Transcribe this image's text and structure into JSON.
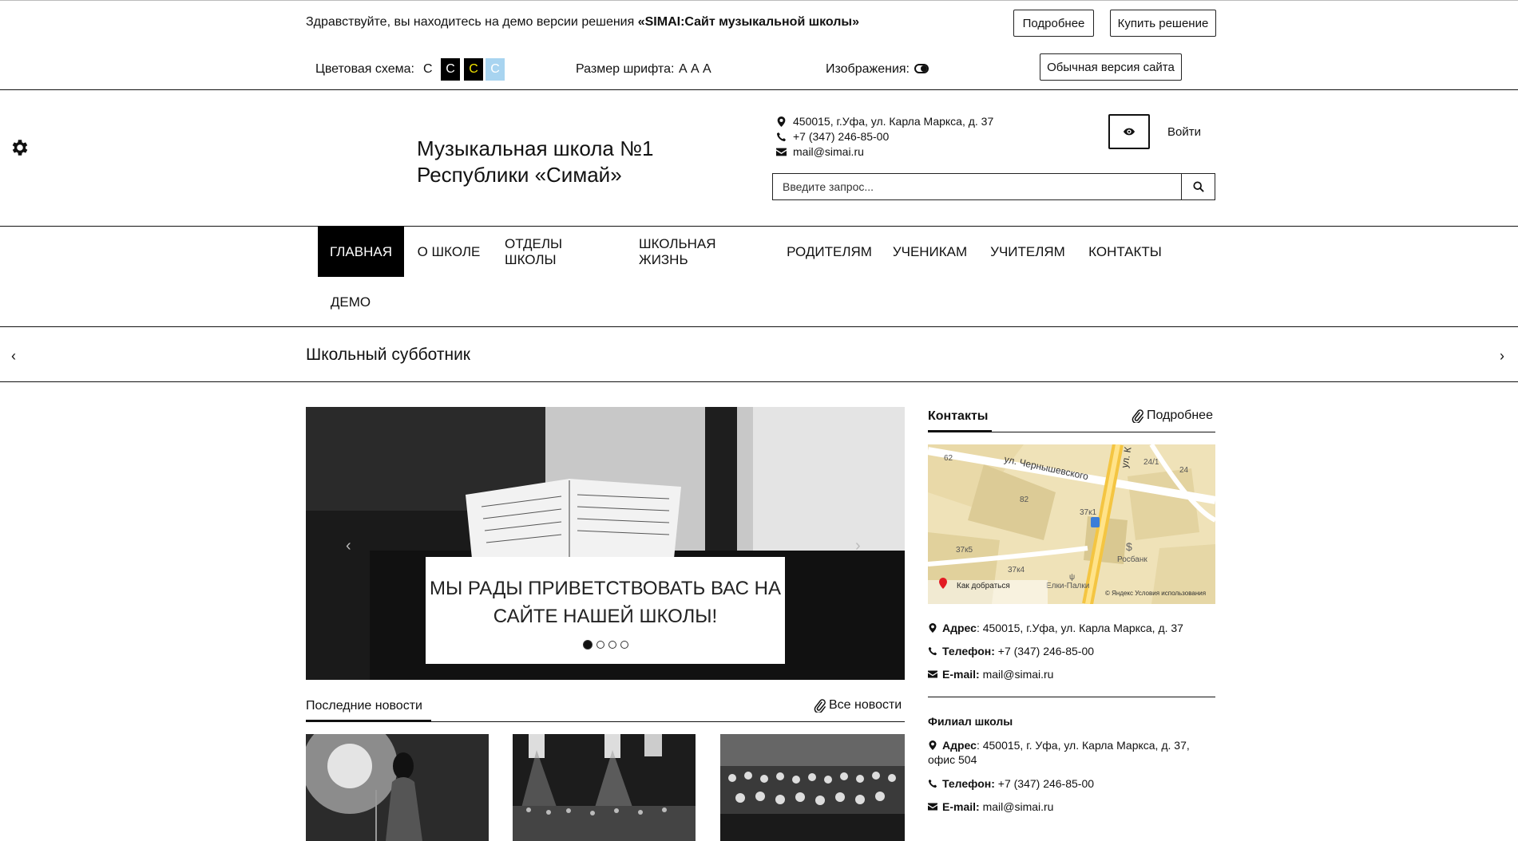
{
  "demo_bar": {
    "text_prefix": "Здравствуйте, вы находитесь на демо версии решения ",
    "text_bold": "«SIMAI:Сайт музыкальной школы»",
    "more_button": "Подробнее",
    "buy_button": "Купить решение"
  },
  "accessibility": {
    "color_scheme_label": "Цветовая схема:",
    "schemes": [
      "C",
      "C",
      "C",
      "C"
    ],
    "font_size_label": "Размер шрифта:",
    "font_sizes": [
      "A",
      "A",
      "A"
    ],
    "images_label": "Изображения:",
    "normal_version_button": "Обычная версия сайта"
  },
  "header": {
    "title_line1": "Музыкальная школа №1",
    "title_line2": "Республики «Симай»",
    "address": "450015, г.Уфа, ул. Карла Маркса, д. 37",
    "phone": "+7 (347) 246-85-00",
    "email": "mail@simai.ru",
    "search_placeholder": "Введите запрос...",
    "login": "Войти"
  },
  "nav": {
    "items": [
      "Главная",
      "О школе",
      "Отделы школы",
      "Школьная жизнь",
      "Родителям",
      "Ученикам",
      "Учителям",
      "Контакты",
      "Демо"
    ]
  },
  "ticker": {
    "text": "Школьный субботник"
  },
  "slider": {
    "caption_line1": "Мы рады приветствовать вас на",
    "caption_line2": "сайте нашей школы!",
    "slide_count": 4,
    "active_index": 0
  },
  "news": {
    "title": "Последние новости",
    "all_link": "Все новости"
  },
  "contacts": {
    "title": "Контакты",
    "more_link": "Подробнее",
    "map": {
      "street1": "ул. Чернышевского",
      "street2": "ул. К",
      "labels": [
        "62",
        "82",
        "37к1",
        "37к5",
        "37к4",
        "24/1",
        "24",
        "Росбанк",
        "Елки-Палки"
      ],
      "route": "Как добраться",
      "terms": "© Яндекс Условия использования"
    },
    "address_label": "Адрес",
    "address": ": 450015, г.Уфа, ул. Карла Маркса, д. 37",
    "phone_label": "Телефон:",
    "phone": " +7 (347) 246-85-00",
    "email_label": "E-mail:",
    "email": " mail@simai.ru",
    "branch_title": "Филиал школы",
    "branch_address_label": "Адрес",
    "branch_address": ": 450015, г. Уфа, ул. Карла Маркса, д. 37,",
    "branch_address2": "офис 504",
    "branch_phone_label": "Телефон:",
    "branch_phone": " +7 (347) 246-85-00",
    "branch_email_label": "E-mail:",
    "branch_email": " mail@simai.ru"
  },
  "colors": {
    "scheme_black": "#000000",
    "scheme_yellow_text": "#f2e400",
    "scheme_blue": "#a8d4f0"
  }
}
